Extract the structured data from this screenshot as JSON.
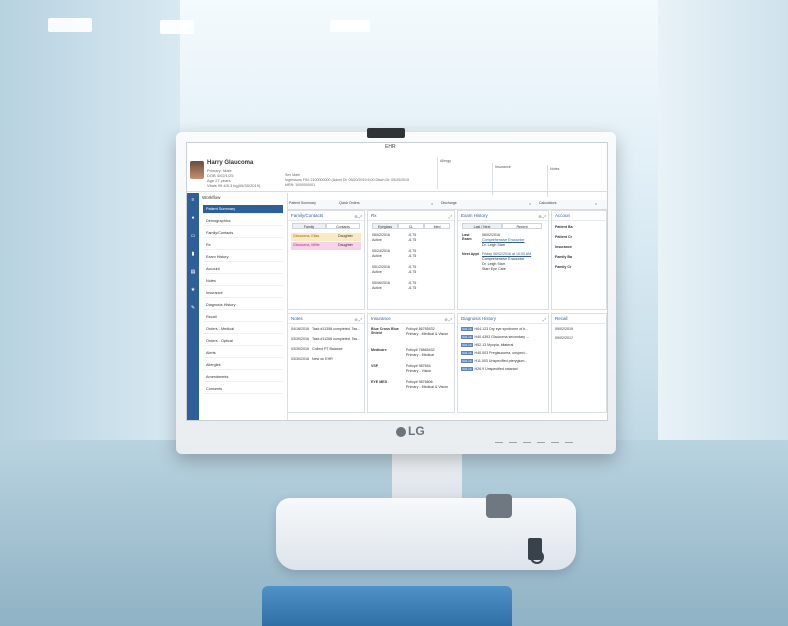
{
  "app": {
    "title": "EHR"
  },
  "patient": {
    "name": "Harry Glaucoma",
    "lines": [
      "Primary: Male",
      "DOB 4/02/1/25",
      "Age 27 years",
      "Vitals 99.4/5.3 kg(09/30/2019)"
    ],
    "mid": [
      "Sex Male",
      "Ingressors FIN: 2100000000 (Admit Dt: 09/20/2019 6:00 Disch Dt: 09/20/2019",
      "MRN: 1000000001"
    ],
    "boxes": [
      "Allergy",
      "Insurance",
      "Notes"
    ]
  },
  "tabs": [
    "Patient Summary",
    "Quick Orders",
    "Discharge",
    "Calculators"
  ],
  "workflow": {
    "title": "Workflow",
    "items": [
      "Patient Summary",
      "Demographics",
      "Family/Contacts",
      "Rx",
      "Exam History",
      "Account",
      "Notes",
      "Insurance",
      "Diagnosis History",
      "Recall",
      "Orders - Medical",
      "Orders - Optical",
      "Alerts",
      "Allergies",
      "Amendments",
      "Consents"
    ]
  },
  "family": {
    "title": "Family/Contacts",
    "tabs": [
      "Family",
      "Contacts"
    ],
    "rows": [
      {
        "name": "Glaucoma, Elias",
        "relation": "Daughter"
      },
      {
        "name": "Glaucoma, Millie",
        "relation": "Daughter"
      }
    ]
  },
  "rx": {
    "title": "Rx",
    "tabs": [
      "Eyeglass",
      "CL",
      "Med"
    ],
    "rows": [
      {
        "date": "06/02/2016",
        "status": "Active",
        "v1": "-6.75",
        "v2": "-6.75"
      },
      {
        "date": "05/24/2016",
        "status": "Active",
        "v1": "-6.75",
        "v2": "-6.75"
      },
      {
        "date": "05/12/2016",
        "status": "Active",
        "v1": "-6.75",
        "v2": "-6.75"
      },
      {
        "date": "05/06/2016",
        "status": "Active",
        "v1": "-6.75",
        "v2": "-6.75"
      }
    ]
  },
  "exam": {
    "title": "Exam History",
    "tabs": [
      "Last / Next",
      "Recent"
    ],
    "last_label": "Last Exam",
    "last_date": "06/02/2016",
    "last_link": "Comprehensive Encounter",
    "last_dr": "Dr. Leigh Starr",
    "next_label": "Next Appt",
    "next_link": "Friday 06/02/2016 at 10:00 AM",
    "next_type": "Comprehensive Encounter",
    "next_dr": "Dr. Leigh Starr",
    "next_loc": "Starr Eye Care"
  },
  "account": {
    "title": "Accoun",
    "rows": [
      "Patient Ba",
      "Patient Cr",
      "Insurance",
      "Family Ba",
      "Family Cr"
    ]
  },
  "notes": {
    "title": "Notes",
    "rows": [
      {
        "date": "04/18/2016",
        "text": "Task #11358 completed. Tas..."
      },
      {
        "date": "03/30/2016",
        "text": "Task #11266 completed. Tas..."
      },
      {
        "date": "03/30/2016",
        "text": "Collect PT Balance"
      },
      {
        "date": "03/30/2016",
        "text": "New on EHR"
      }
    ]
  },
  "insurance": {
    "title": "Insurance",
    "rows": [
      {
        "carrier": "Blue Cross Blue Shield",
        "policy": "Policy# 86765432",
        "type": "Primary - Medical & Vision"
      },
      {
        "carrier": "Medicare",
        "policy": "Policy# 76665432",
        "type": "Primary - Medical"
      },
      {
        "carrier": "VSP",
        "policy": "Policy# 987654",
        "type": "Primary - Vision"
      },
      {
        "carrier": "EYE MED",
        "policy": "Policy# 9876806",
        "type": "Primary - Medical & Vision"
      }
    ]
  },
  "diagnosis": {
    "title": "Diagnosis History",
    "rows": [
      {
        "code": "ICD-10",
        "num": "H04.123",
        "desc": "Dry eye syndrome of b..."
      },
      {
        "code": "ICD-10",
        "num": "H40.4393",
        "desc": "Glaucoma secondary ..."
      },
      {
        "code": "ICD-10",
        "num": "H52.13",
        "desc": "Myopia, bilateral"
      },
      {
        "code": "ICD-10",
        "num": "H40.003",
        "desc": "Preglaucoma, unspeci..."
      },
      {
        "code": "ICD-10",
        "num": "H11.003",
        "desc": "Unspecified pterygium..."
      },
      {
        "code": "ICD-10",
        "num": "H26.9",
        "desc": "Unspecified cataract"
      }
    ]
  },
  "recall": {
    "title": "Recall",
    "rows": [
      "09/02/2019",
      "09/02/2017"
    ]
  },
  "monitor": {
    "brand": "LG"
  }
}
